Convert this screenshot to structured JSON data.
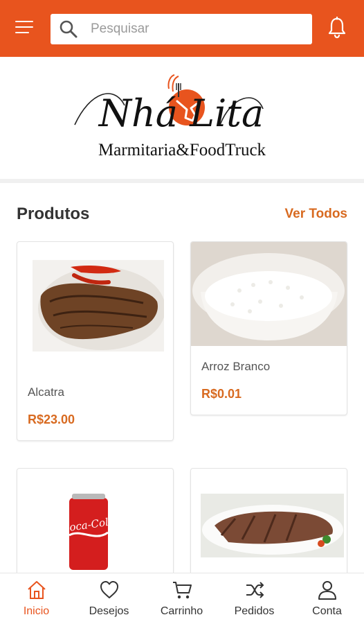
{
  "colors": {
    "primary": "#E8541E",
    "accent_text": "#D86A20"
  },
  "header": {
    "menu_icon": "hamburger-menu-icon",
    "search": {
      "placeholder": "Pesquisar",
      "value": "",
      "icon": "search-icon"
    },
    "notifications_icon": "bell-icon"
  },
  "logo": {
    "brand_name": "Nhá Lita",
    "tagline": "Marmitaria&FoodTruck"
  },
  "products_section": {
    "title": "Produtos",
    "see_all_label": "Ver Todos",
    "items": [
      {
        "name": "Alcatra",
        "price": "R$23.00"
      },
      {
        "name": "Arroz Branco",
        "price": "R$0.01"
      },
      {
        "name": "",
        "price": ""
      },
      {
        "name": "",
        "price": ""
      }
    ]
  },
  "bottom_nav": {
    "items": [
      {
        "label": "Inicio",
        "icon": "home-icon",
        "active": true
      },
      {
        "label": "Desejos",
        "icon": "heart-icon",
        "active": false
      },
      {
        "label": "Carrinho",
        "icon": "cart-icon",
        "active": false
      },
      {
        "label": "Pedidos",
        "icon": "shuffle-icon",
        "active": false
      },
      {
        "label": "Conta",
        "icon": "user-icon",
        "active": false
      }
    ]
  }
}
